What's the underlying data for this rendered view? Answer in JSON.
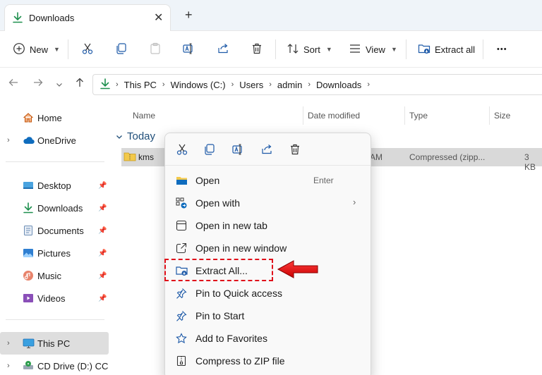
{
  "tab": {
    "title": "Downloads",
    "close": "✕",
    "new_tab": "+"
  },
  "toolbar": {
    "new_label": "New",
    "sort_label": "Sort",
    "view_label": "View",
    "extract_all_label": "Extract all",
    "more": "•••"
  },
  "address": {
    "crumbs": [
      "This PC",
      "Windows (C:)",
      "Users",
      "admin",
      "Downloads"
    ]
  },
  "sidebar": {
    "items": [
      {
        "label": "Home"
      },
      {
        "label": "OneDrive"
      },
      {
        "label": "Desktop"
      },
      {
        "label": "Downloads"
      },
      {
        "label": "Documents"
      },
      {
        "label": "Pictures"
      },
      {
        "label": "Music"
      },
      {
        "label": "Videos"
      },
      {
        "label": "This PC"
      },
      {
        "label": "CD Drive (D:) CCCC"
      }
    ]
  },
  "columns": {
    "name": "Name",
    "date": "Date modified",
    "type": "Type",
    "size": "Size"
  },
  "group": {
    "label": "Today"
  },
  "file": {
    "name": "kms",
    "date_tail": "AM",
    "type": "Compressed (zipp...",
    "size": "3 KB"
  },
  "context_menu": {
    "items": [
      {
        "label": "Open",
        "shortcut": "Enter"
      },
      {
        "label": "Open with",
        "arrow": "›"
      },
      {
        "label": "Open in new tab"
      },
      {
        "label": "Open in new window"
      },
      {
        "label": "Extract All..."
      },
      {
        "label": "Pin to Quick access"
      },
      {
        "label": "Pin to Start"
      },
      {
        "label": "Add to Favorites"
      },
      {
        "label": "Compress to ZIP file"
      }
    ]
  },
  "colors": {
    "accent": "#0067c0",
    "highlight": "#e0101a",
    "download_green": "#1e8f4e"
  }
}
